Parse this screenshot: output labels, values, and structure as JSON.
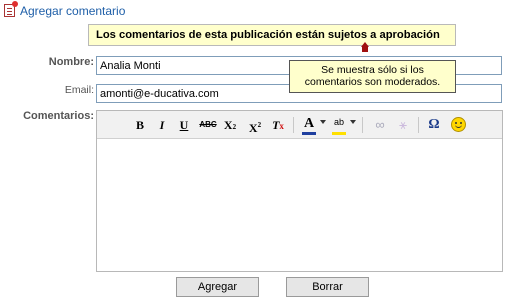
{
  "header": {
    "title": "Agregar comentario",
    "icon": "comment-add-icon"
  },
  "notice": {
    "text": "Los comentarios de esta publicación están sujetos a aprobación"
  },
  "tooltip": {
    "line1": "Se muestra sólo si los",
    "line2": "comentarios son moderados."
  },
  "form": {
    "name_label": "Nombre:",
    "name_value": "Analia Monti",
    "email_label": "Email:",
    "email_value": "amonti@e-ducativa.com",
    "comments_label": "Comentarios:",
    "comments_value": ""
  },
  "toolbar": {
    "bold": "B",
    "italic": "I",
    "underline": "U",
    "strike": "ABC",
    "subscript": "X",
    "superscript": "X",
    "remove_format": "T",
    "text_color": "A",
    "bg_color": "ab",
    "link": "∞",
    "unlink": "⚹",
    "special_char": "Ω",
    "smiley_icon": "smiley-icon"
  },
  "buttons": {
    "add": "Agregar",
    "clear": "Borrar"
  },
  "colors": {
    "title": "#1f5fa8",
    "notice_bg": "#ffffcc",
    "arrow": "#a01010"
  }
}
